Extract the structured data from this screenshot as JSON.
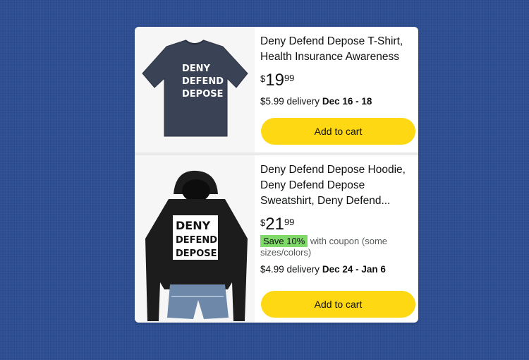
{
  "products": [
    {
      "title_line1": "Deny Defend Depose T-Shirt,",
      "title_line2": "Health Insurance Awareness",
      "price_symbol": "$",
      "price_whole": "19",
      "price_fraction": "99",
      "delivery_cost": "$5.99 delivery",
      "delivery_dates": "Dec 16 - 18",
      "cart_label": "Add to cart",
      "shirt_text": [
        "DENY",
        "DEFEND",
        "DEPOSE"
      ],
      "shirt_color": "#3a4255"
    },
    {
      "title_line1": "Deny Defend Depose Hoodie,",
      "title_line2": "Deny Defend Depose",
      "title_line3": "Sweatshirt, Deny Defend...",
      "price_symbol": "$",
      "price_whole": "21",
      "price_fraction": "99",
      "coupon_badge": "Save 10%",
      "coupon_text_1": "with coupon (some",
      "coupon_text_2": "sizes/colors)",
      "delivery_cost": "$4.99 delivery",
      "delivery_dates": "Dec 24 - Jan 6",
      "cart_label": "Add to cart",
      "hoodie_text": [
        "DENY",
        "DEFEND",
        "DEPOSE"
      ],
      "hoodie_color": "#1c1c1c"
    }
  ],
  "colors": {
    "background": "#2e4f93",
    "cart_button": "#ffd814",
    "coupon_badge": "#7fda69"
  }
}
